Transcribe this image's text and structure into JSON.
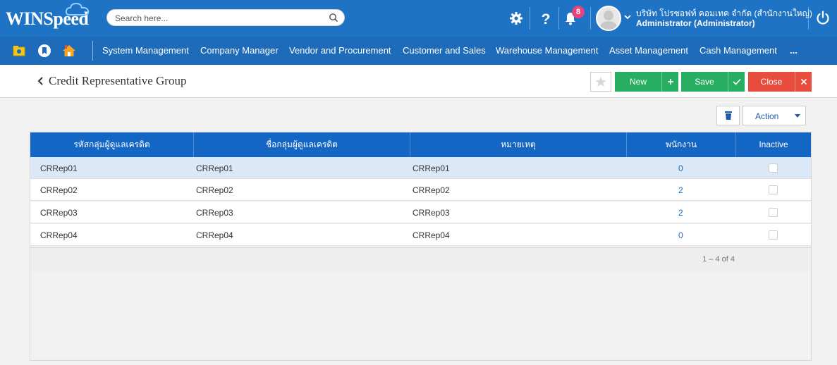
{
  "app": {
    "logo_text": "WINSpeed",
    "search_placeholder": "Search here...",
    "notification_count": "8",
    "company_name": "บริษัท โปรซอฟท์ คอมเทค จำกัด (สำนักงานใหญ่)",
    "user_name": "Administrator (Administrator)"
  },
  "menu": {
    "items": [
      "System Management",
      "Company Manager",
      "Vendor and Procurement",
      "Customer and Sales",
      "Warehouse Management",
      "Asset Management",
      "Cash Management",
      "..."
    ]
  },
  "page": {
    "title": "Credit Representative Group",
    "buttons": {
      "new": "New",
      "save": "Save",
      "close": "Close",
      "action": "Action"
    }
  },
  "table": {
    "columns": [
      "รหัสกลุ่มผู้ดูแลเครดิต",
      "ชื่อกลุ่มผู้ดูแลเครดิต",
      "หมายเหตุ",
      "พนักงาน",
      "Inactive"
    ],
    "rows": [
      {
        "code": "CRRep01",
        "name": "CRRep01",
        "remark": "CRRep01",
        "employees": "0",
        "inactive": false
      },
      {
        "code": "CRRep02",
        "name": "CRRep02",
        "remark": "CRRep02",
        "employees": "2",
        "inactive": false
      },
      {
        "code": "CRRep03",
        "name": "CRRep03",
        "remark": "CRRep03",
        "employees": "2",
        "inactive": false
      },
      {
        "code": "CRRep04",
        "name": "CRRep04",
        "remark": "CRRep04",
        "employees": "0",
        "inactive": false
      }
    ],
    "pager": "1 – 4 of 4"
  },
  "colors": {
    "header_blue": "#1f73c4",
    "menu_blue": "#1e6cb9",
    "grid_head_blue": "#1466c4",
    "green": "#27ae60",
    "red": "#e74c3c",
    "selected_row": "#dbe8f8"
  },
  "icons": {
    "settings": "gear-icon",
    "help": "question-icon",
    "notifications": "bell-icon",
    "power": "power-icon",
    "search": "search-icon",
    "favorite": "star-icon",
    "delete": "trash-icon"
  }
}
